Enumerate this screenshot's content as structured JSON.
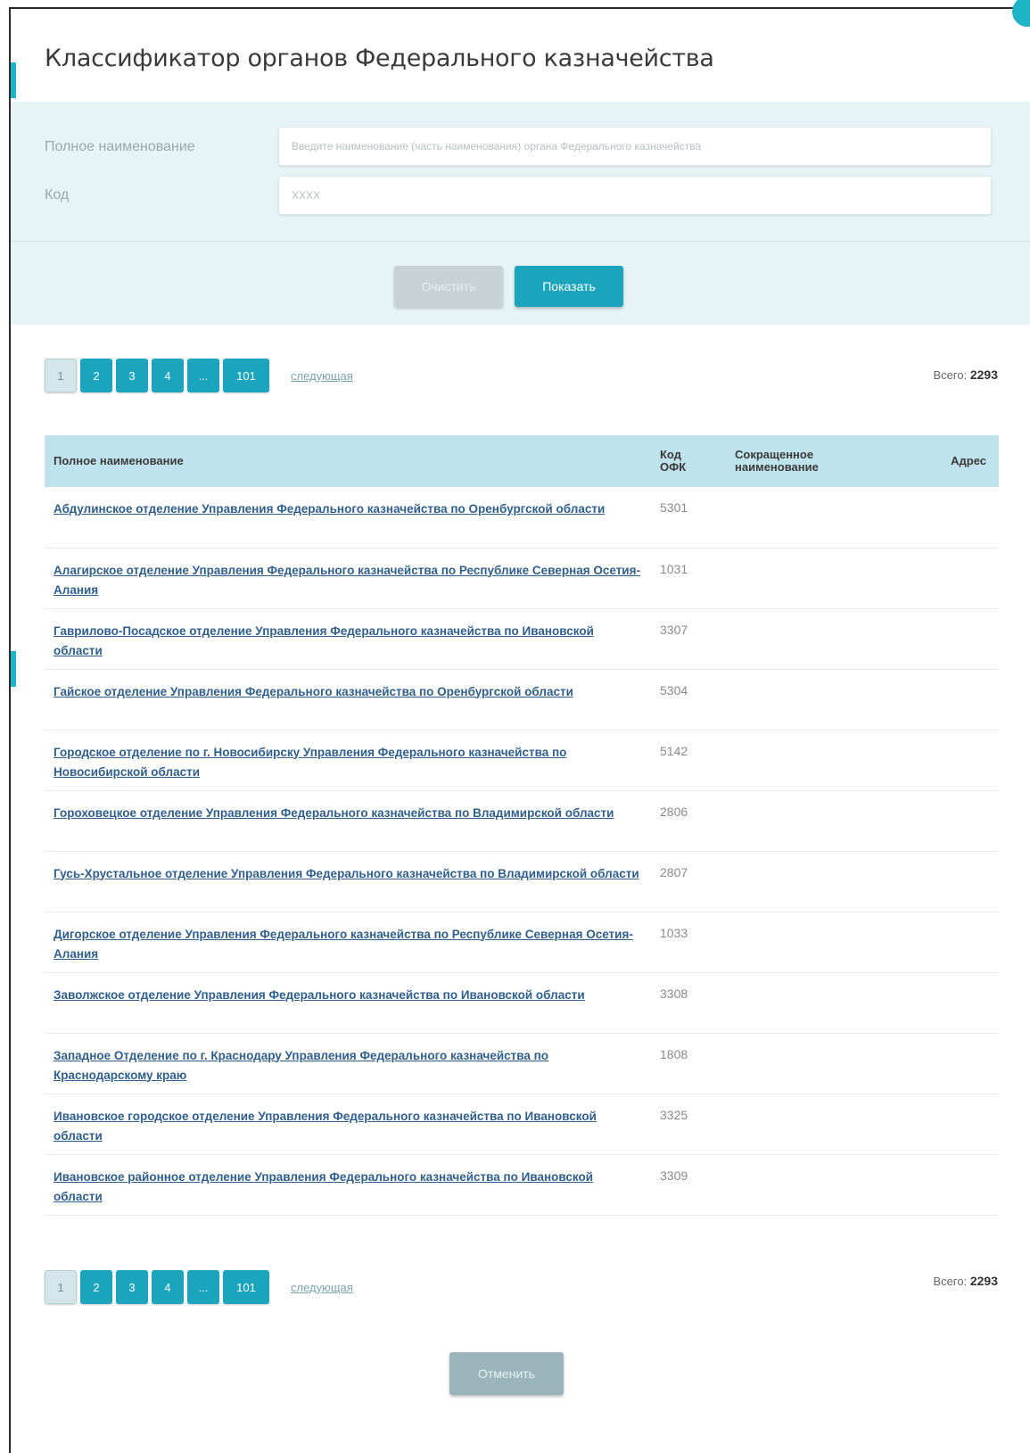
{
  "dialog": {
    "title": "Классификатор органов Федерального казначейства"
  },
  "filters": {
    "full_name_label": "Полное наименование",
    "full_name_placeholder": "Введите наименование (часть наименования) органа Федерального казначейства",
    "code_label": "Код",
    "code_placeholder": "XXXX",
    "clear_label": "Очистить",
    "show_label": "Показать"
  },
  "pagination": {
    "pages": [
      "1",
      "2",
      "3",
      "4",
      "...",
      "101"
    ],
    "active": "1",
    "next_label": "следующая",
    "total_label": "Всего:",
    "total_value": "2293"
  },
  "table": {
    "headers": {
      "full_name": "Полное наименование",
      "code_line1": "Код",
      "code_line2": "ОФК",
      "short_name_line1": "Сокращенное",
      "short_name_line2": "наименование",
      "address": "Адрес"
    },
    "rows": [
      {
        "name": "Абдулинское отделение Управления Федерального казначейства по Оренбургской области",
        "code": "5301",
        "short": "",
        "address": ""
      },
      {
        "name": "Алагирское отделение Управления Федерального казначейства по Республике Северная Осетия-Алания",
        "code": "1031",
        "short": "",
        "address": ""
      },
      {
        "name": "Гаврилово-Посадское отделение Управления Федерального казначейства по Ивановской области",
        "code": "3307",
        "short": "",
        "address": ""
      },
      {
        "name": "Гайское отделение Управления Федерального казначейства по Оренбургской области",
        "code": "5304",
        "short": "",
        "address": ""
      },
      {
        "name": "Городское отделение по г. Новосибирску Управления Федерального казначейства по Новосибирской области",
        "code": "5142",
        "short": "",
        "address": ""
      },
      {
        "name": "Гороховецкое отделение Управления Федерального казначейства по Владимирской области",
        "code": "2806",
        "short": "",
        "address": ""
      },
      {
        "name": "Гусь-Хрустальное отделение Управления Федерального казначейства по Владимирской области",
        "code": "2807",
        "short": "",
        "address": ""
      },
      {
        "name": "Дигорское отделение Управления Федерального казначейства по Республике Северная Осетия-Алания",
        "code": "1033",
        "short": "",
        "address": ""
      },
      {
        "name": "Заволжское отделение Управления Федерального казначейства по Ивановской области",
        "code": "3308",
        "short": "",
        "address": ""
      },
      {
        "name": "Западное Отделение по г. Краснодару Управления Федерального казначейства по Краснодарскому краю",
        "code": "1808",
        "short": "",
        "address": ""
      },
      {
        "name": "Ивановское городское отделение Управления Федерального казначейства по Ивановской области",
        "code": "3325",
        "short": "",
        "address": ""
      },
      {
        "name": "Ивановское районное отделение Управления Федерального казначейства по Ивановской области",
        "code": "3309",
        "short": "",
        "address": ""
      }
    ]
  },
  "footer": {
    "cancel_label": "Отменить"
  },
  "colors": {
    "accent": "#1aa5bd",
    "header_bg": "#bfe3ec",
    "panel_bg": "#e6f3f7",
    "link": "#2f5f8a"
  }
}
